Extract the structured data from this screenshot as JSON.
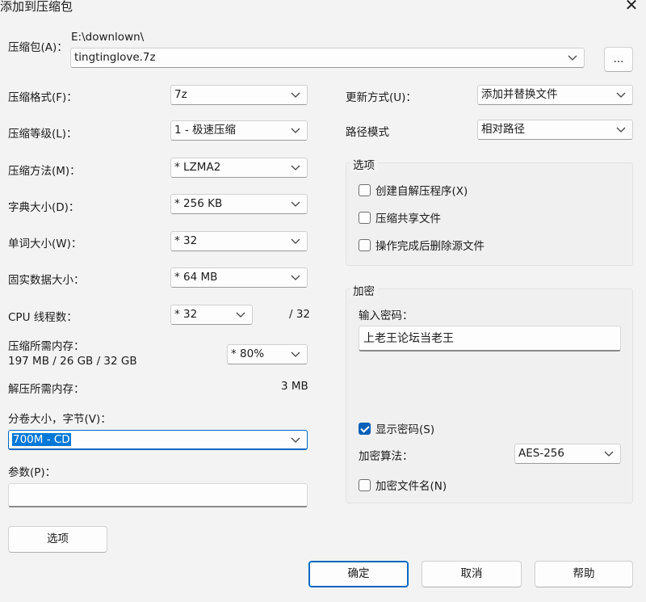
{
  "window": {
    "title": "添加到压缩包"
  },
  "archive": {
    "label": "压缩包(A)：",
    "path": "E:\\downlown\\",
    "name": "tingtinglove.7z",
    "browse_label": "..."
  },
  "left": {
    "format_label": "压缩格式(F)：",
    "format_value": "7z",
    "level_label": "压缩等级(L)：",
    "level_value": "1 - 极速压缩",
    "method_label": "压缩方法(M)：",
    "method_value": "*  LZMA2",
    "dict_label": "字典大小(D)：",
    "dict_value": "*  256 KB",
    "word_label": "单词大小(W)：",
    "word_value": "*  32",
    "solid_label": "固实数据大小：",
    "solid_value": "*  64 MB",
    "cpu_label": "CPU 线程数：",
    "cpu_value": "*  32",
    "cpu_total": "/ 32",
    "mem_compress_label": "压缩所需内存：",
    "mem_compress_value": "197 MB / 26 GB / 32 GB",
    "mem_percent": "*  80%",
    "mem_decompress_label": "解压所需内存：",
    "mem_decompress_value": "3 MB",
    "split_label": "分卷大小，字节(V)：",
    "split_value": "700M - CD",
    "params_label": "参数(P)：",
    "params_value": "",
    "options_button": "选项"
  },
  "right": {
    "update_label": "更新方式(U)：",
    "update_value": "添加并替换文件",
    "path_mode_label": "路径模式",
    "path_mode_value": "相对路径",
    "options_group": {
      "title": "选项",
      "sfx": "创建自解压程序(X)",
      "shared": "压缩共享文件",
      "delete": "操作完成后删除源文件"
    },
    "encrypt_group": {
      "title": "加密",
      "password_label": "输入密码：",
      "password_value": "上老王论坛当老王",
      "show_password": "显示密码(S)",
      "method_label": "加密算法：",
      "method_value": "AES-256",
      "encrypt_names": "加密文件名(N)"
    }
  },
  "footer": {
    "ok": "确定",
    "cancel": "取消",
    "help": "帮助"
  },
  "colors": {
    "accent": "#005fb8",
    "selection": "#0078d7"
  }
}
